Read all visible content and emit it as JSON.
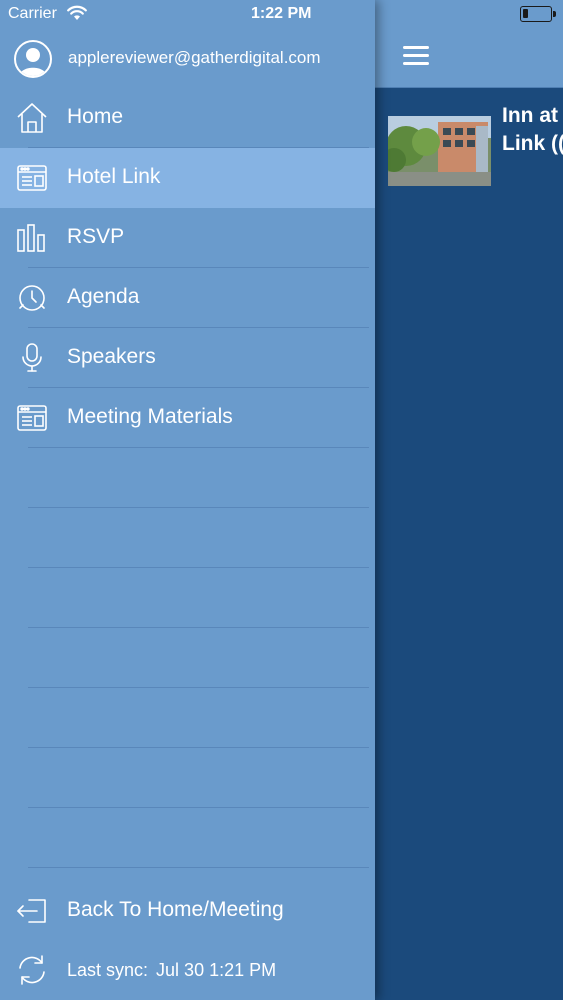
{
  "status_bar": {
    "carrier": "Carrier",
    "time": "1:22 PM"
  },
  "account": {
    "email": "applereviewer@gatherdigital.com"
  },
  "nav": {
    "items": [
      {
        "label": "Home",
        "icon": "home-icon",
        "active": false
      },
      {
        "label": "Hotel Link",
        "icon": "browser-window-icon",
        "active": true
      },
      {
        "label": "RSVP",
        "icon": "bar-chart-icon",
        "active": false
      },
      {
        "label": "Agenda",
        "icon": "alarm-clock-icon",
        "active": false
      },
      {
        "label": "Speakers",
        "icon": "microphone-icon",
        "active": false
      },
      {
        "label": "Meeting Materials",
        "icon": "browser-window-icon",
        "active": false
      }
    ]
  },
  "footer": {
    "back_label": "Back To Home/Meeting",
    "sync_prefix": "Last sync:",
    "sync_time": "Jul 30 1:21 PM"
  },
  "content": {
    "hotel_title_line1": "Inn at",
    "hotel_title_line2": "Link (("
  },
  "colors": {
    "drawer_bg": "#6a9bcc",
    "active_row": "#86b3e3",
    "content_bg": "#1b4a7c"
  }
}
